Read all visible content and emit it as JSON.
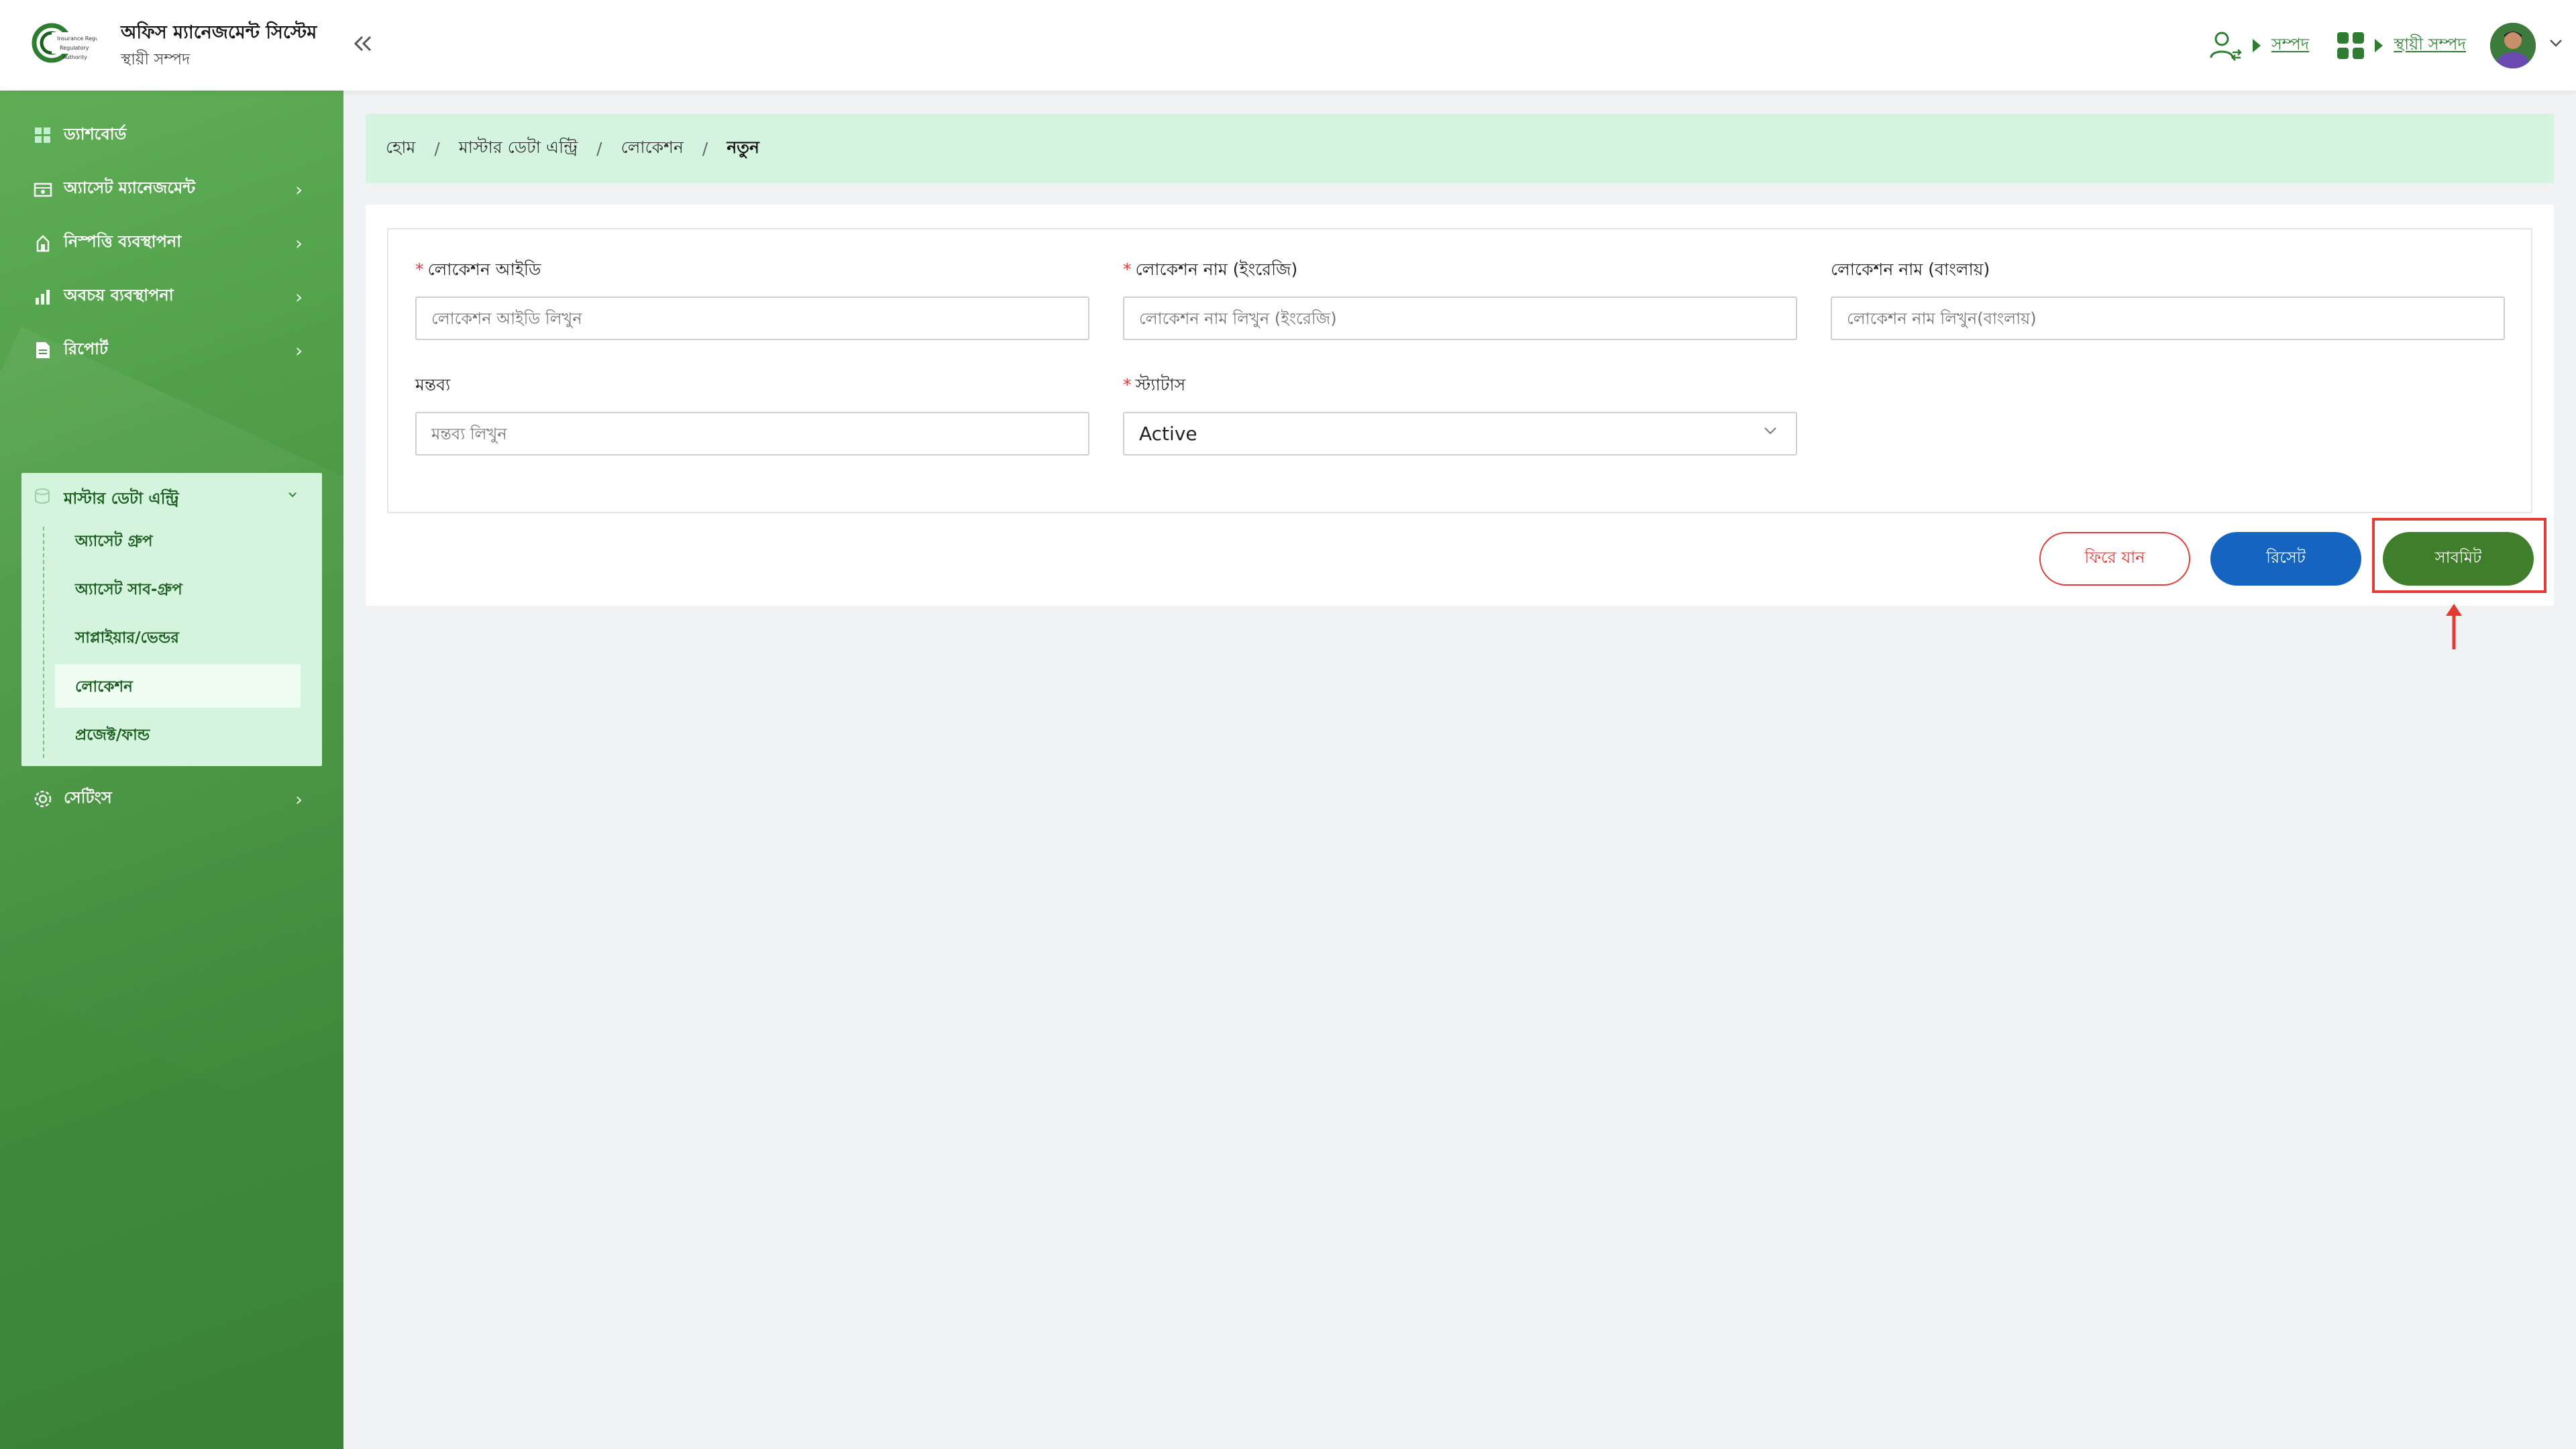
{
  "header": {
    "logo_text": "Insurance Regulatory Authority",
    "app_title": "অফিস ম্যানেজমেন্ট সিস্টেম",
    "app_subtitle": "স্থায়ী সম্পদ",
    "collapse_icon": "double-chevron-left-icon",
    "link_resource": "সম্পদ",
    "link_fixed_asset": "স্থায়ী সম্পদ"
  },
  "sidebar": {
    "items": [
      {
        "label": "ড্যাশবোর্ড",
        "icon": "dashboard-icon"
      },
      {
        "label": "অ্যাসেট ম্যানেজমেন্ট",
        "icon": "asset-management-icon"
      },
      {
        "label": "নিস্পত্তি ব্যবস্থাপনা",
        "icon": "disposal-icon"
      },
      {
        "label": "অবচয় ব্যবস্থাপনা",
        "icon": "depreciation-icon"
      },
      {
        "label": "রিপোর্ট",
        "icon": "report-icon"
      },
      {
        "label": "সেটিংস",
        "icon": "settings-icon"
      }
    ],
    "master_data": {
      "label": "মাস্টার ডেটা এন্ট্রি",
      "children": [
        {
          "label": "অ্যাসেট গ্রুপ"
        },
        {
          "label": "অ্যাসেট সাব-গ্রুপ"
        },
        {
          "label": "সাপ্লাইয়ার/ভেন্ডর"
        },
        {
          "label": "লোকেশন"
        },
        {
          "label": "প্রজেক্ট/ফান্ড"
        }
      ],
      "active": "লোকেশন"
    }
  },
  "breadcrumb": {
    "items": [
      "হোম",
      "মাস্টার ডেটা এন্ট্রি",
      "লোকেশন"
    ],
    "current": "নতুন",
    "separator": "/"
  },
  "form": {
    "location_id": {
      "label": "লোকেশন আইডি",
      "placeholder": "লোকেশন আইডি লিখুন",
      "required": true
    },
    "location_name_en": {
      "label": "লোকেশন নাম (ইংরেজি)",
      "placeholder": "লোকেশন নাম লিখুন (ইংরেজি)",
      "required": true
    },
    "location_name_bn": {
      "label": "লোকেশন নাম (বাংলায়)",
      "placeholder": "লোকেশন নাম লিখুন(বাংলায়)",
      "required": false
    },
    "remarks": {
      "label": "মন্তব্য",
      "placeholder": "মন্তব্য লিখুন",
      "required": false
    },
    "status": {
      "label": "স্ট্যাটাস",
      "value": "Active",
      "required": true
    },
    "required_mark": "*"
  },
  "buttons": {
    "back": "ফিরে যান",
    "reset": "রিসেট",
    "submit": "সাবমিট"
  },
  "colors": {
    "brand_green": "#3f7e2a",
    "sidebar_green": "#4c9a45",
    "breadcrumb_bg": "#d4f4e0",
    "reset_blue": "#1565c0",
    "back_red": "#e53935",
    "annotation_red": "#e53935"
  }
}
